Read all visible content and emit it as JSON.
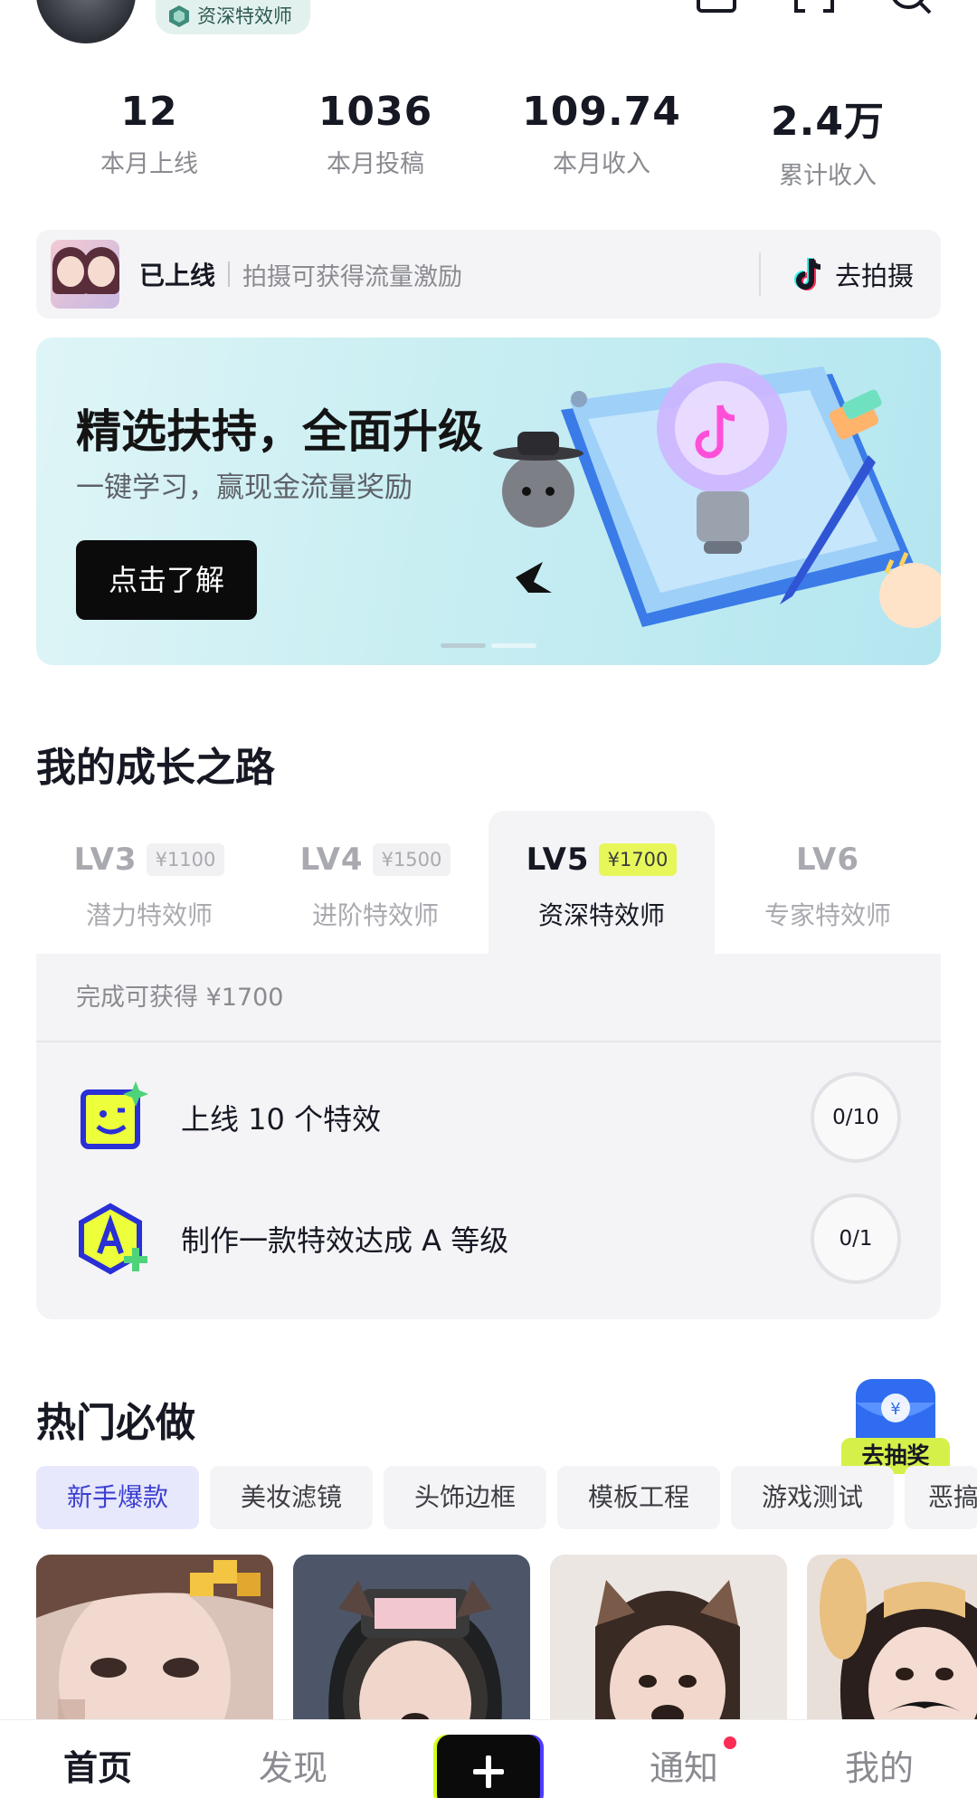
{
  "profile": {
    "title_badge": "资深特效师"
  },
  "stats": [
    {
      "value": "12",
      "label": "本月上线"
    },
    {
      "value": "1036",
      "label": "本月投稿"
    },
    {
      "value": "109.74",
      "label": "本月收入"
    },
    {
      "value": "2.4万",
      "label": "累计收入"
    }
  ],
  "online": {
    "status": "已上线",
    "description": "拍摄可获得流量激励",
    "action": "去拍摄"
  },
  "banner": {
    "title": "精选扶持，全面升级",
    "subtitle": "一键学习，赢现金流量奖励",
    "button": "点击了解"
  },
  "growth": {
    "title": "我的成长之路",
    "levels": [
      {
        "name": "LV3",
        "price": "¥1100",
        "title": "潜力特效师"
      },
      {
        "name": "LV4",
        "price": "¥1500",
        "title": "进阶特效师"
      },
      {
        "name": "LV5",
        "price": "¥1700",
        "title": "资深特效师"
      },
      {
        "name": "LV6",
        "price": "",
        "title": "专家特效师"
      }
    ],
    "active_level": 2,
    "reward": "完成可获得 ¥1700",
    "tasks": [
      {
        "label": "上线 10 个特效",
        "progress": "0/10"
      },
      {
        "label": "制作一款特效达成 A 等级",
        "progress": "0/1"
      }
    ]
  },
  "hot": {
    "title": "热门必做",
    "lottery_label": "去抽奖",
    "tags": [
      "新手爆款",
      "美妆滤镜",
      "头饰边框",
      "模板工程",
      "游戏测试",
      "恶搞"
    ]
  },
  "nav": {
    "home": "首页",
    "discover": "发现",
    "notifications": "通知",
    "me": "我的"
  },
  "colors": {
    "accent_lime": "#e7f75a",
    "active_tag_text": "#3c3fd1",
    "notification_dot": "#fe2c55"
  }
}
